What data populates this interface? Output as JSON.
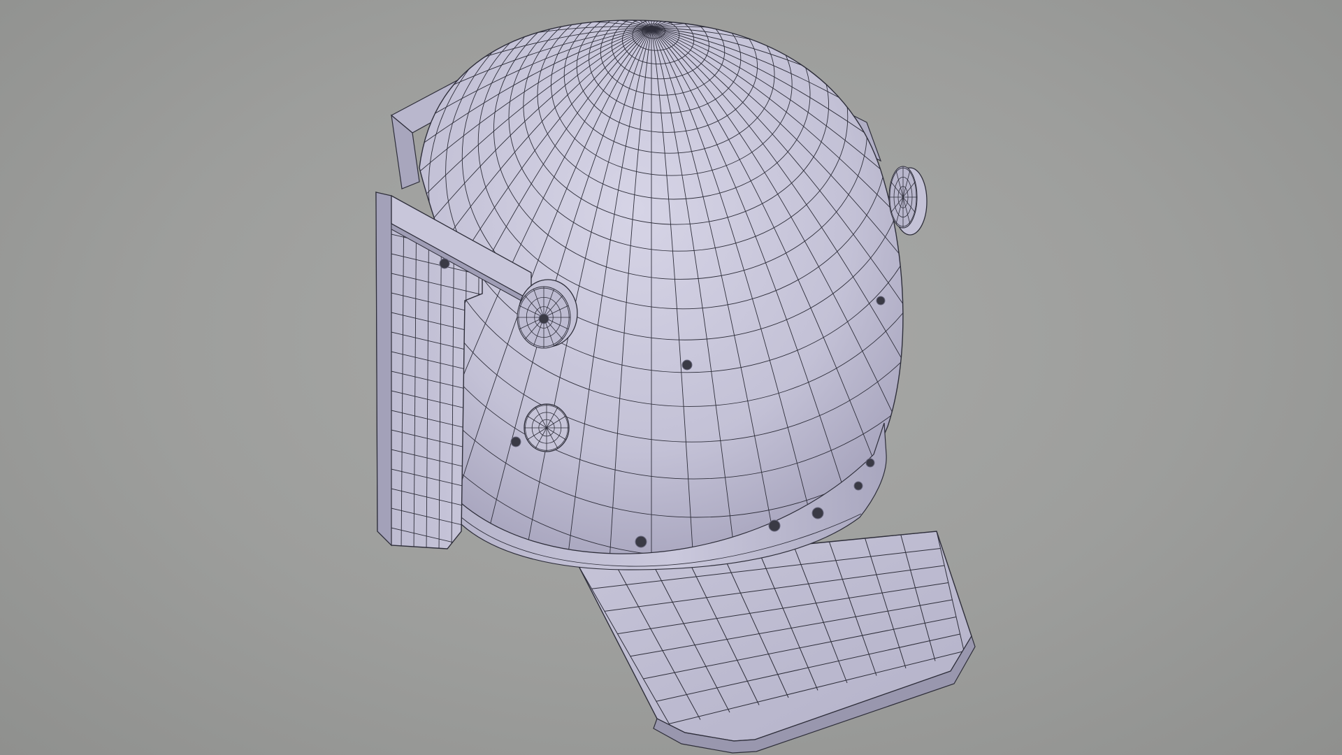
{
  "scene": {
    "subject": "helmet-wireframe-model",
    "colors": {
      "background": "#9e9f9d",
      "surface": "#c7c5d8",
      "surface_shade": "#9c99b3",
      "wire": "#2e2e3a",
      "rivet": "#3a3a45"
    }
  }
}
